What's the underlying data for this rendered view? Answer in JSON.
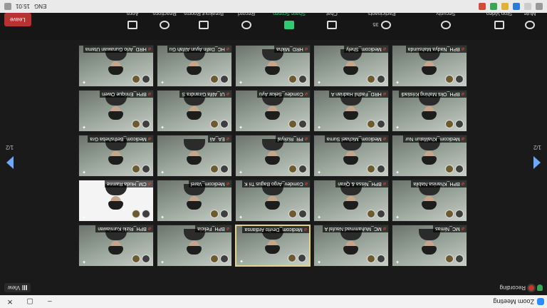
{
  "window": {
    "title": "Zoom Meeting"
  },
  "top": {
    "recording": "Recording",
    "view": "View"
  },
  "pager": {
    "left": "1/2",
    "right": "1/2"
  },
  "tiles": [
    {
      "name": "MC_Nimas",
      "sub": "",
      "active": false
    },
    {
      "name": "MC_Muhammad Naufal A",
      "sub": "",
      "active": false
    },
    {
      "name": "Medicom_Devito Ardiansa",
      "sub": "",
      "active": true
    },
    {
      "name": "BPH_Felicia",
      "sub": "",
      "active": false
    },
    {
      "name": "BPH_Rizki Kurniawan",
      "sub": "",
      "active": false
    },
    {
      "name": "BPH_Khanisa Nabila",
      "sub": "",
      "active": false
    },
    {
      "name": "BPH_Nissa & Qiran",
      "sub": "",
      "active": false
    },
    {
      "name": "Comdev_Argo Bagus Tri K",
      "sub": "",
      "active": false
    },
    {
      "name": "Medicom_Varel",
      "sub": "",
      "active": false
    },
    {
      "name": "CM_Huda Ramne",
      "sub": "",
      "active": false,
      "white": true
    },
    {
      "name": "Medicom_Khalifatun Nur",
      "sub": "",
      "active": false
    },
    {
      "name": "Medicom_Michael Surna",
      "sub": "",
      "active": false
    },
    {
      "name": "PR_Rizkyal",
      "sub": "",
      "active": false
    },
    {
      "name": "EA_Ali",
      "sub": "",
      "active": false
    },
    {
      "name": "Medicom_Bethsheba Gra",
      "sub": "",
      "active": false
    },
    {
      "name": "BPH_Okti Mahing Kristiadi",
      "sub": "",
      "active": false
    },
    {
      "name": "HRD_Fadhil Hadrian A",
      "sub": "",
      "active": false
    },
    {
      "name": "Comdev_Sekar Ayu",
      "sub": "",
      "active": false
    },
    {
      "name": "UI_Alifa Girandra S",
      "sub": "",
      "active": false
    },
    {
      "name": "BPH_Enrique Owen",
      "sub": "",
      "active": false
    },
    {
      "name": "BPH_Nadya Mahsunda",
      "sub": "",
      "active": false
    },
    {
      "name": "Medicom_Shely",
      "sub": "",
      "active": false
    },
    {
      "name": "HRD_Mikha",
      "sub": "",
      "active": false
    },
    {
      "name": "HC_Dafin Ayun Alifah Gu",
      "sub": "",
      "active": false
    },
    {
      "name": "HRD_Ario Gunawan Utama",
      "sub": "",
      "active": false
    }
  ],
  "toolbar": {
    "mute": "Mute",
    "stop_video": "Stop Video",
    "security": "Security",
    "participants": "Participants",
    "participants_count": "35",
    "chat": "Chat",
    "share_screen": "Share Screen",
    "record": "Record",
    "breakout": "Breakout Rooms",
    "reactions": "Reactions",
    "apps": "Apps",
    "leave": "Leave"
  },
  "tray": {
    "time": "15:01",
    "lang": "ENG"
  },
  "colors": {
    "accent": "#2ecc71",
    "leave": "#b83232",
    "active_border": "#e5d18a"
  }
}
